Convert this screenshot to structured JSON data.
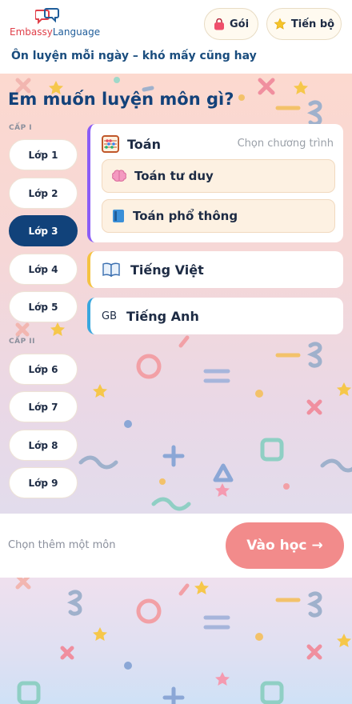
{
  "brand": {
    "name_part1": "Embassy",
    "name_part2": "Language"
  },
  "header": {
    "goi_label": "Gói",
    "tienbo_label": "Tiến bộ",
    "tagline": "Ôn luyện mỗi ngày – khó mấy cũng hay"
  },
  "question": "Em muốn luyện môn gì?",
  "grades": {
    "cap1_label": "CẤP I",
    "cap2_label": "CẤP II",
    "items": [
      "Lớp 1",
      "Lớp 2",
      "Lớp 3",
      "Lớp 4",
      "Lớp 5",
      "Lớp 6",
      "Lớp 7",
      "Lớp 8",
      "Lớp 9"
    ],
    "selected": "Lớp 3"
  },
  "subjects": {
    "math": {
      "label": "Toán",
      "choose_program": "Chọn chương trình",
      "options": [
        "Toán tư duy",
        "Toán phổ thông"
      ]
    },
    "vietnamese": {
      "label": "Tiếng Việt"
    },
    "english": {
      "prefix": "GB",
      "label": "Tiếng Anh"
    }
  },
  "footer": {
    "add_subject": "Chọn thêm một môn",
    "cta_label": "Vào học",
    "cta_arrow": "→"
  },
  "icons": {
    "goi": "bag-icon",
    "tienbo": "star-icon",
    "math": "abacus-icon",
    "thinking_math": "brain-icon",
    "general_math": "book-icon",
    "vietnamese": "open-book-icon"
  },
  "colors": {
    "primary": "#11427a",
    "cta": "#f28b8b",
    "math_accent": "#8b5cf6",
    "viet_accent": "#f5c342",
    "english_accent": "#39a7de"
  }
}
